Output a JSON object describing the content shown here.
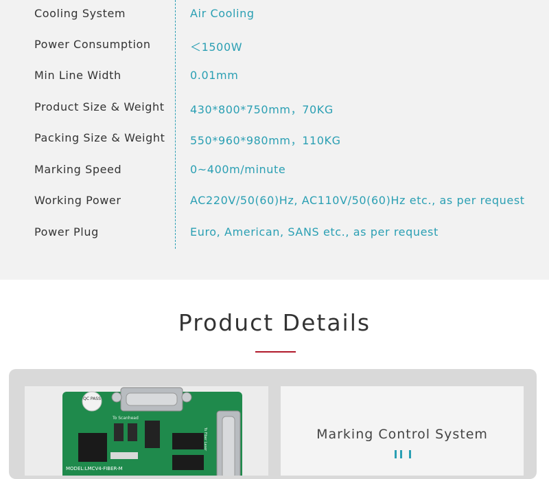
{
  "specs": {
    "rows": [
      {
        "label": "Cooling System",
        "value": "Air Cooling"
      },
      {
        "label": "Power Consumption",
        "value": "＜1500W"
      },
      {
        "label": "Min Line Width",
        "value": "0.01mm"
      },
      {
        "label": "Product Size & Weight",
        "value": "430*800*750mm，70KG"
      },
      {
        "label": "Packing Size & Weight",
        "value": "550*960*980mm，110KG"
      },
      {
        "label": "Marking Speed",
        "value": "0~400m/minute"
      },
      {
        "label": "Working Power",
        "value": "AC220V/50(60)Hz, AC110V/50(60)Hz etc., as per request"
      },
      {
        "label": "Power Plug",
        "value": "Euro, American, SANS etc., as per request"
      }
    ]
  },
  "details": {
    "title": "Product Details",
    "accent_color": "#b0182a"
  },
  "gallery": {
    "board_labels": {
      "qc_pass": "QC PASS",
      "to_scanhead": "To Scanhead",
      "to_fiber_laser": "To Fiber Laser",
      "model": "MODEL:LMCV4-FIBER-M"
    },
    "caption": "Marking Control System",
    "accent_color": "#2a9fb3"
  }
}
